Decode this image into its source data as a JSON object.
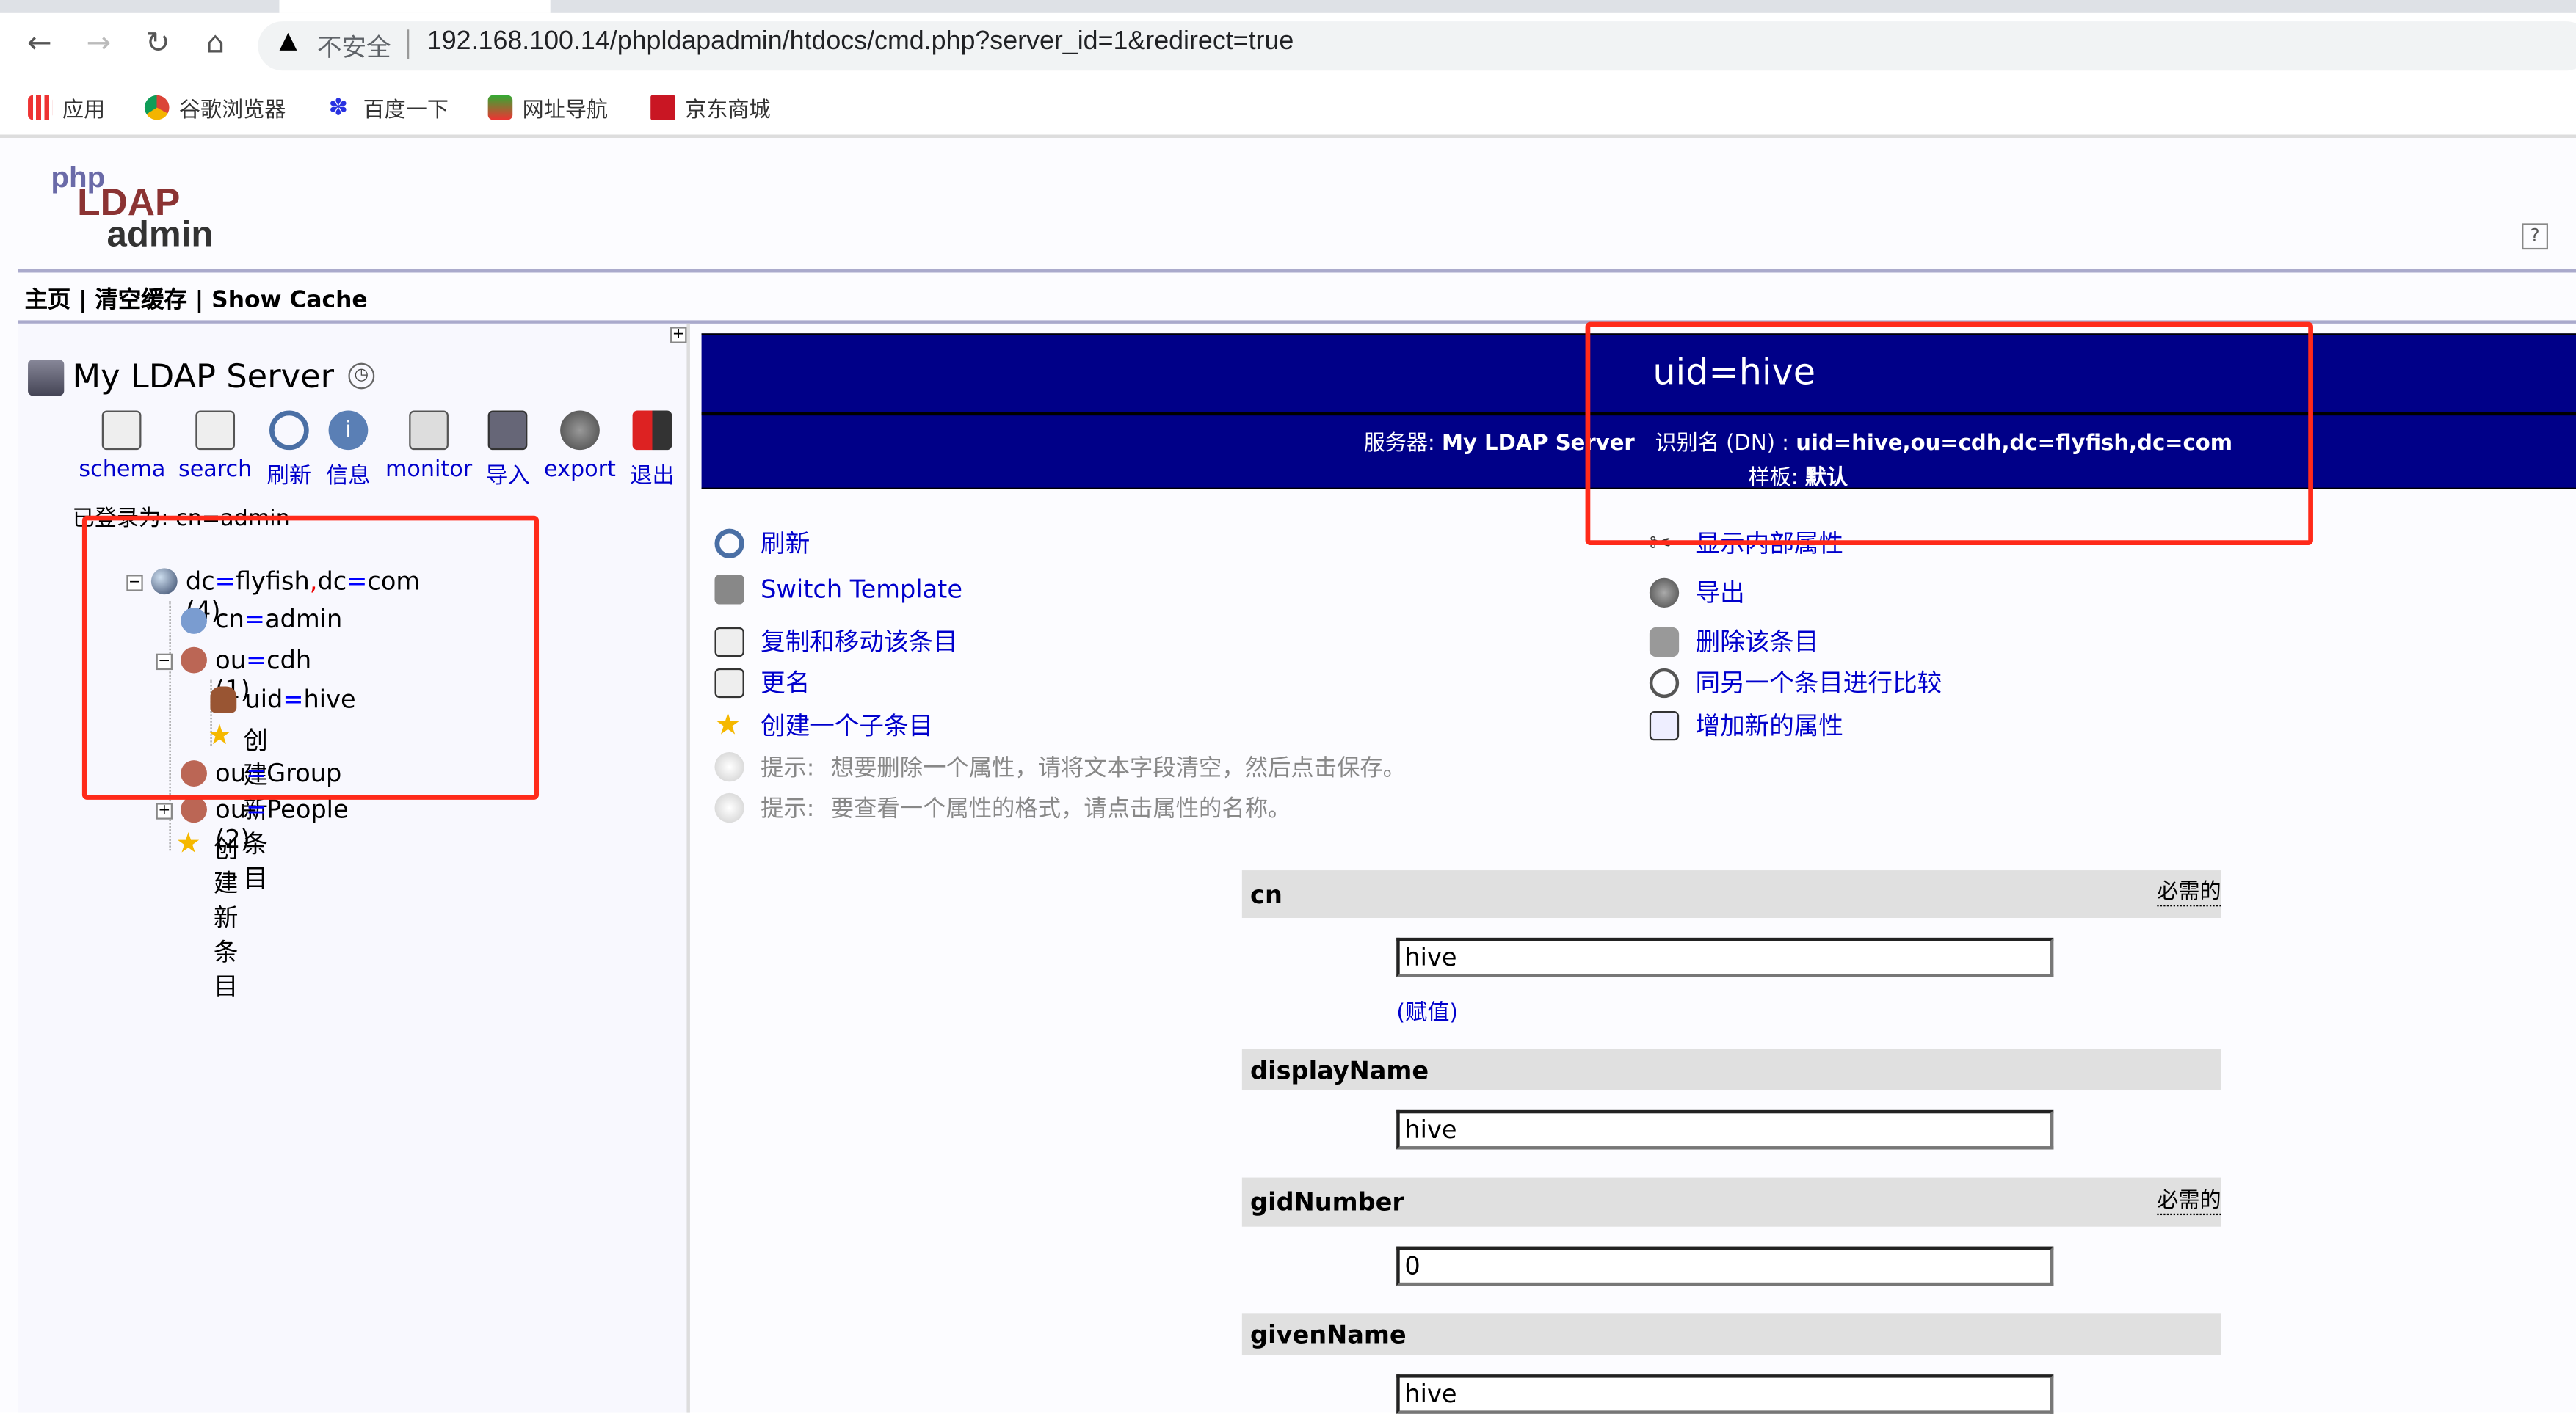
{
  "browser": {
    "url": "192.168.100.14/phpldapadmin/htdocs/cmd.php?server_id=1&redirect=true",
    "security_label": "不安全",
    "bookmarks": [
      {
        "label": "应用",
        "icon": "apps-grid-icon"
      },
      {
        "label": "谷歌浏览器",
        "icon": "chrome-icon"
      },
      {
        "label": "百度一下",
        "icon": "baidu-paw-icon"
      },
      {
        "label": "网址导航",
        "icon": "2345-icon"
      },
      {
        "label": "京东商城",
        "icon": "jd-icon"
      }
    ]
  },
  "app": {
    "logo_text": "php LDAP admin",
    "top_links": [
      "主页",
      "清空缓存",
      "Show Cache"
    ],
    "separator": "|"
  },
  "sidebar": {
    "server_name": "My LDAP Server",
    "toolbar": [
      {
        "label": "schema",
        "icon": "schema-icon"
      },
      {
        "label": "search",
        "icon": "search-icon"
      },
      {
        "label": "刷新",
        "icon": "refresh-icon"
      },
      {
        "label": "信息",
        "icon": "info-icon"
      },
      {
        "label": "monitor",
        "icon": "monitor-icon"
      },
      {
        "label": "导入",
        "icon": "import-icon"
      },
      {
        "label": "export",
        "icon": "export-icon"
      },
      {
        "label": "退出",
        "icon": "logout-icon"
      }
    ],
    "logged_in": "已登录为: cn=admin",
    "tree": {
      "root": {
        "a": "dc",
        "b": "flyfish",
        "c": "dc",
        "d": "com",
        "count": "(4)"
      },
      "items": [
        {
          "attr": "cn",
          "val": "admin"
        },
        {
          "attr": "ou",
          "val": "cdh",
          "count": "(1)"
        },
        {
          "attr": "uid",
          "val": "hive"
        },
        {
          "label": "创建新条目"
        },
        {
          "attr": "ou",
          "val": "Group"
        },
        {
          "attr": "ou",
          "val": "People",
          "count": "(2)"
        },
        {
          "label": "创建新条目"
        }
      ]
    }
  },
  "entry": {
    "title": "uid=hive",
    "server_label": "服务器:",
    "server": "My LDAP Server",
    "dn_label": "识别名 (DN) :",
    "dn": "uid=hive,ou=cdh,dc=flyfish,dc=com",
    "template_label": "样板:",
    "template": "默认",
    "actions_left": [
      "刷新",
      "Switch Template",
      "复制和移动该条目",
      "更名",
      "创建一个子条目"
    ],
    "actions_right": [
      "显示内部属性",
      "导出",
      "删除该条目",
      "同另一个条目进行比较",
      "增加新的属性"
    ],
    "hints": [
      {
        "label": "提示:",
        "text": "想要删除一个属性，请将文本字段清空，然后点击保存。"
      },
      {
        "label": "提示:",
        "text": "要查看一个属性的格式，请点击属性的名称。"
      }
    ],
    "required_label": "必需的",
    "assign_label": "(赋值)",
    "attributes": [
      {
        "name": "cn",
        "value": "hive",
        "required": true
      },
      {
        "name": "displayName",
        "value": "hive",
        "required": false
      },
      {
        "name": "gidNumber",
        "value": "0",
        "required": true
      },
      {
        "name": "givenName",
        "value": "hive",
        "required": false
      }
    ]
  },
  "colors": {
    "banner": "#000088",
    "link": "#0000cc",
    "annotation": "#ff2a1a"
  }
}
